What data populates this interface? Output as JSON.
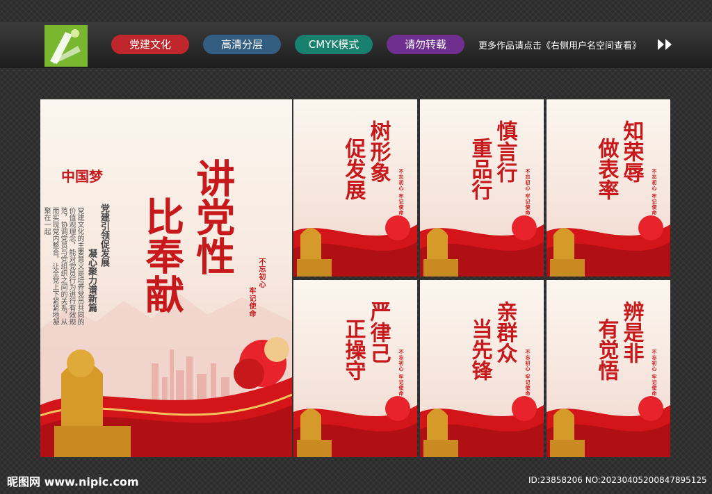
{
  "header": {
    "pills": [
      {
        "label": "党建文化",
        "color": "#c0272d"
      },
      {
        "label": "高清分层",
        "color": "#345d82"
      },
      {
        "label": "CMYK模式",
        "color": "#17816e"
      },
      {
        "label": "请勿转载",
        "color": "#6f2f8e"
      }
    ],
    "note": "更多作品请点击《右侧用户名空间查看》",
    "logo_icon": "pen-nib-icon"
  },
  "main_poster": {
    "title_right": "讲党性",
    "title_left": "比奉献",
    "logo_text": "中国梦",
    "subtitle_1": "党建引领促发展",
    "subtitle_2": "凝心聚力谱新篇",
    "body": "党建文化的主要意义是培养党员共同的价值观理念，能对党员行为进行有效规范，协调党员与党组织之间的关系，从而实现党内整合，让全党上下紧紧地凝聚在一起",
    "stamp_1": "不忘初心",
    "stamp_2": "牢记使命"
  },
  "small_posters": [
    {
      "col1": "树形象",
      "col2": "促发展"
    },
    {
      "col1": "慎言行",
      "col2": "重品行"
    },
    {
      "col1": "知荣辱",
      "col2": "做表率"
    },
    {
      "col1": "严律己",
      "col2": "正操守"
    },
    {
      "col1": "亲群众",
      "col2": "当先锋"
    },
    {
      "col1": "辨是非",
      "col2": "有觉悟"
    }
  ],
  "small_common": {
    "sub": "党建引领促发展 凝心聚力谱新篇",
    "stamp": "不忘初心 牢记使命"
  },
  "footer": {
    "brand": "昵图网 www.nipic.com",
    "id": "ID:23858206 NO:20230405200847895125"
  }
}
